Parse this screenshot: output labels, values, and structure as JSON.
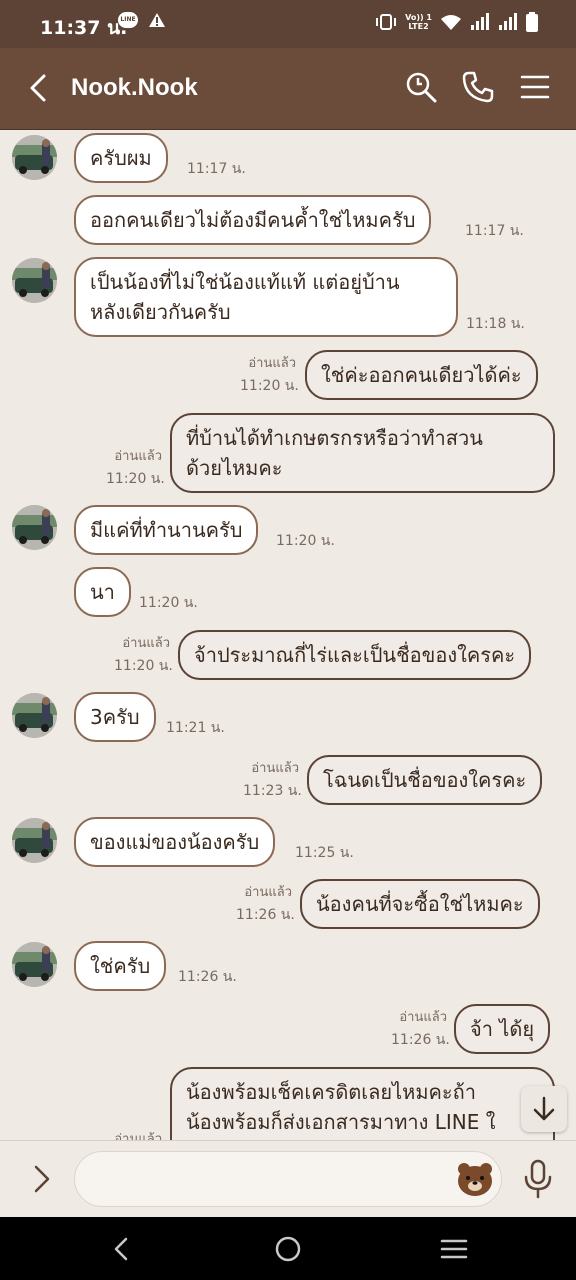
{
  "status_bar": {
    "time": "11:37 น.",
    "lte_line1": "Vo)) 1",
    "lte_line2": "LTE2",
    "line_badge": "LINE"
  },
  "header": {
    "title": "Nook.Nook"
  },
  "input": {
    "placeholder": ""
  },
  "colors": {
    "header_bg": "#6b4c3b",
    "status_bg": "#5c4335",
    "chat_bg": "#efeae4",
    "bubble_border": "#8b6a55"
  },
  "messages": [
    {
      "side": "in",
      "text": "ครับผม",
      "time": "11:17 น."
    },
    {
      "side": "in",
      "text": "ออกคนเดียวไม่ต้องมีคนค้ำใช่ไหมครับ",
      "time": "11:17 น."
    },
    {
      "side": "in",
      "text": "เป็นน้องที่ไม่ใช่น้องแท้แท้ แต่อยู่บ้าน",
      "text2": "หลังเดียวกันครับ",
      "time": "11:18 น."
    },
    {
      "side": "out",
      "text": "ใช่ค่ะออกคนเดียวได้ค่ะ",
      "time": "11:20 น.",
      "read": "อ่านแล้ว"
    },
    {
      "side": "out",
      "text": "ที่บ้านได้ทำเกษตรกรหรือว่าทำสวน",
      "text2": "ด้วยไหมคะ",
      "time": "11:20 น.",
      "read": "อ่านแล้ว"
    },
    {
      "side": "in",
      "text": "มีแค่ที่ทำนานครับ",
      "time": "11:20 น."
    },
    {
      "side": "in",
      "text": "นา",
      "time": "11:20 น."
    },
    {
      "side": "out",
      "text": "จ้าประมาณกี่ไร่และเป็นชื่อของใครคะ",
      "time": "11:20 น.",
      "read": "อ่านแล้ว"
    },
    {
      "side": "in",
      "text": "3ครับ",
      "time": "11:21 น."
    },
    {
      "side": "out",
      "text": "โฉนดเป็นชื่อของใครคะ",
      "time": "11:23 น.",
      "read": "อ่านแล้ว"
    },
    {
      "side": "in",
      "text": "ของแม่ของน้องครับ",
      "time": "11:25 น."
    },
    {
      "side": "out",
      "text": "น้องคนที่จะซื้อใช่ไหมคะ",
      "time": "11:26 น.",
      "read": "อ่านแล้ว"
    },
    {
      "side": "in",
      "text": "ใช่ครับ",
      "time": "11:26 น."
    },
    {
      "side": "out",
      "text": "จ้า ได้ยุ",
      "time": "11:26 น.",
      "read": "อ่านแล้ว"
    },
    {
      "side": "out",
      "text": "น้องพร้อมเช็คเครดิตเลยไหมคะถ้า",
      "text2": "น้องพร้อมก็ส่งเอกสารมาทาง LINE ใ",
      "read": "อ่านแล้ว"
    }
  ]
}
